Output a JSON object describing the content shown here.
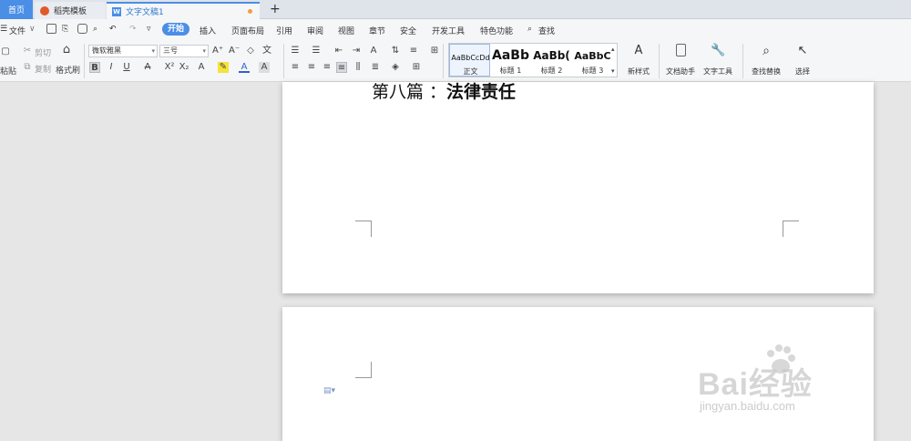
{
  "tabs": [
    {
      "label": "首页"
    },
    {
      "label": "稻壳模板"
    },
    {
      "label": "文字文稿1"
    }
  ],
  "menu": {
    "file": "文件",
    "start": "开始",
    "items": [
      "插入",
      "页面布局",
      "引用",
      "审阅",
      "视图",
      "章节",
      "安全",
      "开发工具",
      "特色功能"
    ],
    "search": "查找"
  },
  "ribbon": {
    "paste": "粘贴",
    "cut": "剪切",
    "copy": "复制",
    "format_painter": "格式刷",
    "font_name": "微软雅黑",
    "font_size": "三号",
    "styles": [
      {
        "preview": "AaBbCcDd",
        "name": "正文"
      },
      {
        "preview": "AaBb",
        "name": "标题 1"
      },
      {
        "preview": "AaBb(",
        "name": "标题 2"
      },
      {
        "preview": "AaBbC",
        "name": "标题 3"
      }
    ],
    "new_style": "新样式",
    "doc_assistant": "文档助手",
    "text_tools": "文字工具",
    "find_replace": "查找替换",
    "select": "选择"
  },
  "document": {
    "heading_prefix": "第八篇 ：",
    "heading_bold": "法律责任"
  },
  "watermark": {
    "brand": "Bai经验",
    "url": "jingyan.baidu.com"
  },
  "colors": {
    "accent": "#4a8ee6",
    "tab_dot": "#f0a040"
  }
}
